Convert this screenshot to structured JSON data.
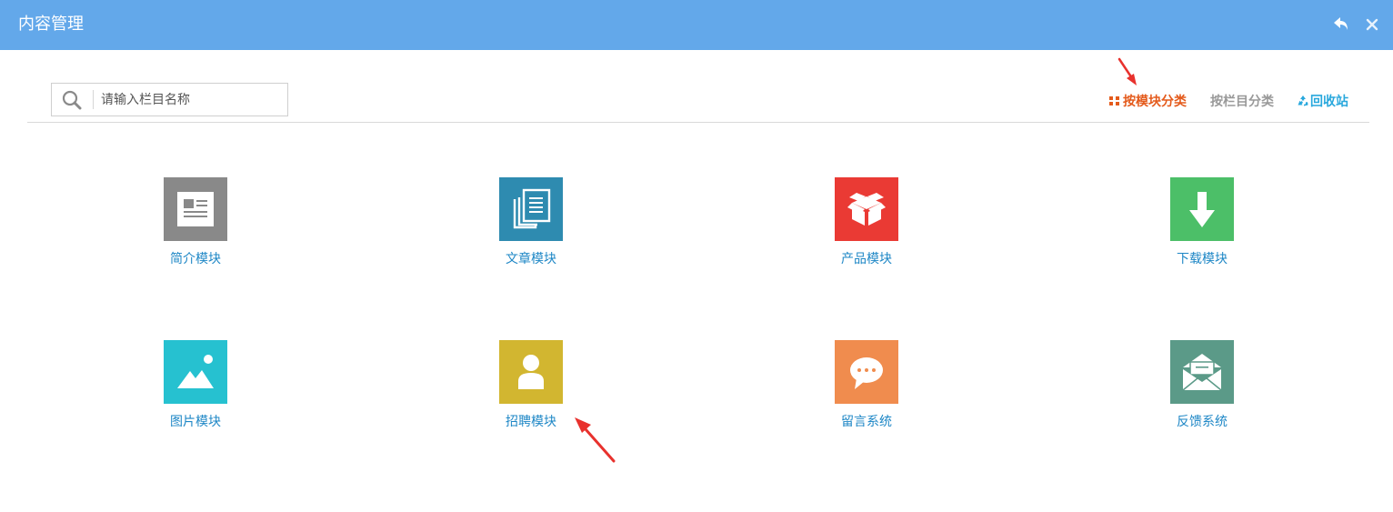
{
  "window": {
    "title": "内容管理",
    "back_icon": "back-arrow-icon",
    "close_icon": "close-icon"
  },
  "search": {
    "placeholder": "请输入栏目名称",
    "value": "",
    "icon": "search-icon"
  },
  "view_options": {
    "by_module": "按模块分类",
    "by_column": "按栏目分类",
    "recycle_bin": "回收站",
    "active": "by_module",
    "colors": {
      "active": "#e45a1b",
      "inactive": "#999999",
      "recycle": "#29a8dd"
    }
  },
  "modules": [
    {
      "label": "简介模块",
      "icon": "newspaper-icon",
      "color": "#898989"
    },
    {
      "label": "文章模块",
      "icon": "documents-icon",
      "color": "#2e8bb0"
    },
    {
      "label": "产品模块",
      "icon": "open-box-icon",
      "color": "#ea3a34"
    },
    {
      "label": "下载模块",
      "icon": "download-arrow-icon",
      "color": "#4cbf68"
    },
    {
      "label": "图片模块",
      "icon": "image-icon",
      "color": "#26c1d0"
    },
    {
      "label": "招聘模块",
      "icon": "person-icon",
      "color": "#d2b630"
    },
    {
      "label": "留言系统",
      "icon": "chat-bubble-icon",
      "color": "#f08c4e"
    },
    {
      "label": "反馈系统",
      "icon": "envelope-icon",
      "color": "#5b9a88"
    }
  ],
  "colors": {
    "titlebar": "#63a8ea",
    "tile_label": "#1e87c6",
    "annotation_arrow": "#e8312d"
  }
}
